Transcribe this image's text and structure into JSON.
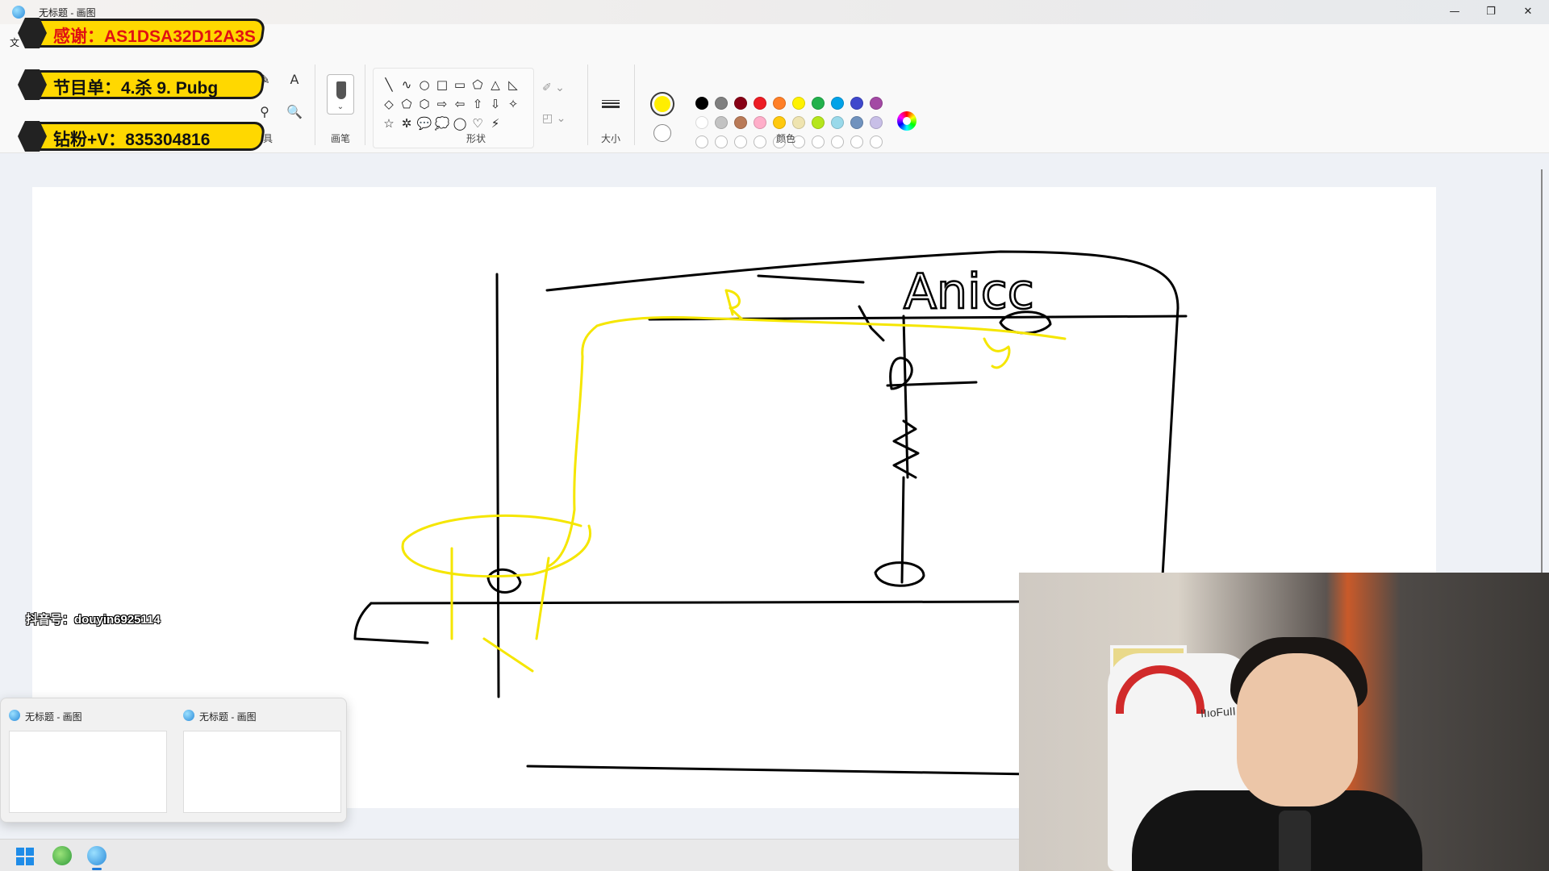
{
  "window": {
    "title": "无标题 - 画图",
    "controls": {
      "minimize": "—",
      "restore": "❐",
      "close": "✕"
    }
  },
  "ribbon": {
    "file_menu": "文",
    "groups": {
      "tools_label": "具",
      "brushes_label": "画笔",
      "shapes_label": "形状",
      "size_label": "大小",
      "colors_label": "颜色"
    },
    "tools": [
      "✎",
      "A",
      "⚲",
      "🔍"
    ],
    "shapes": [
      "╲",
      "∿",
      "○",
      "□",
      "▭",
      "⬠",
      "△",
      "◺",
      "◇",
      "⬠",
      "⬡",
      "⇨",
      "⇦",
      "⇧",
      "⇩",
      "✧",
      "☆",
      "✲",
      "💬",
      "💭",
      "◯",
      "♡",
      "⚡"
    ],
    "primary_color": "#ffee00",
    "secondary_color": "#ffffff",
    "palette": [
      "#000000",
      "#7f7f7f",
      "#880015",
      "#ed1c24",
      "#ff7f27",
      "#fff200",
      "#22b14c",
      "#00a2e8",
      "#3f48cc",
      "#a349a4",
      "#ffffff",
      "#c3c3c3",
      "#b97a57",
      "#ffaec9",
      "#ffc90e",
      "#efe4b0",
      "#b5e61d",
      "#99d9ea",
      "#7092be",
      "#c8bfe7"
    ],
    "empty_swatches": 10
  },
  "overlays": {
    "banner1": "感谢：AS1DSA32D12A3S",
    "banner2": "节目单：4.杀 9. Pubg",
    "banner3": "钻粉+V：835304816",
    "douyin_id": "抖音号：douyin6925114"
  },
  "canvas": {
    "drawn_text": "Anicc"
  },
  "taskbar_preview": {
    "thumbs": [
      {
        "title": "无标题 - 画图"
      },
      {
        "title": "无标题 - 画图"
      }
    ]
  }
}
